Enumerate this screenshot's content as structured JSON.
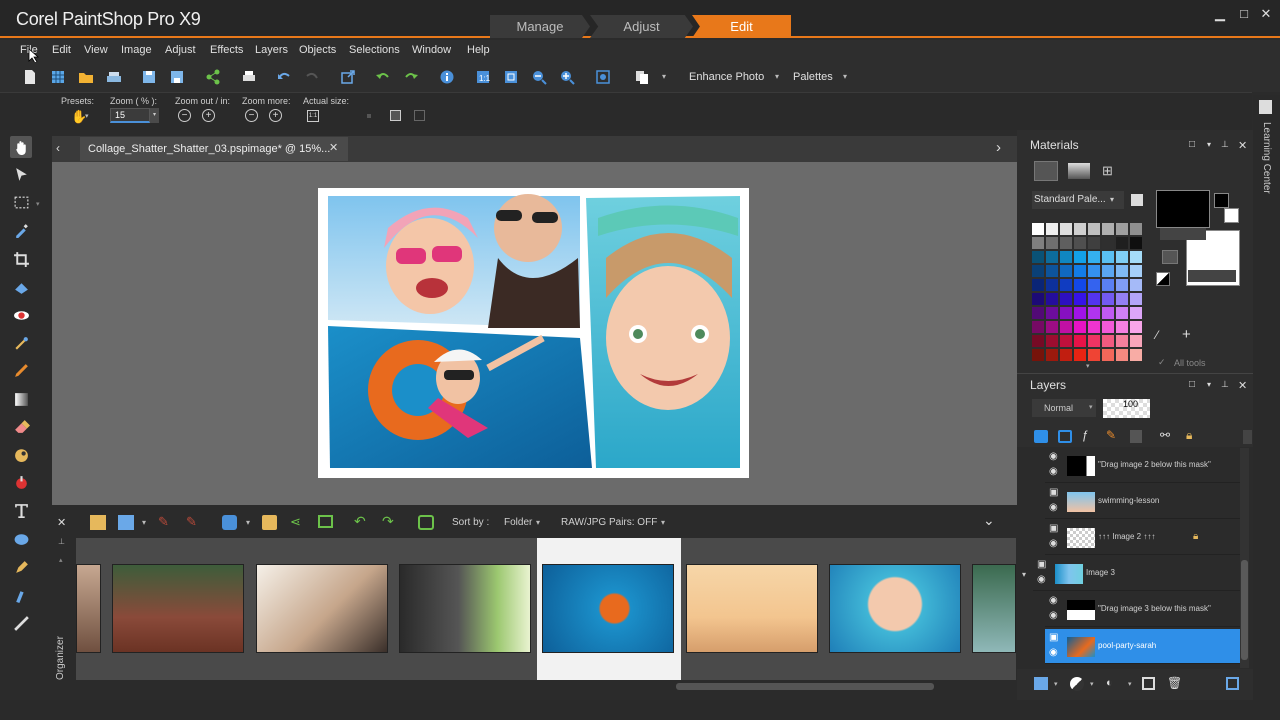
{
  "app": {
    "title": "Corel PaintShop Pro X9"
  },
  "workspace_tabs": [
    "Manage",
    "Adjust",
    "Edit"
  ],
  "menu": [
    "File",
    "Edit",
    "View",
    "Image",
    "Adjust",
    "Effects",
    "Layers",
    "Objects",
    "Selections",
    "Window",
    "Help"
  ],
  "toolbar": {
    "enhance_photo": "Enhance Photo",
    "palettes": "Palettes"
  },
  "tool_options": {
    "presets": "Presets:",
    "zoom_pct": "Zoom ( % ):",
    "zoom_value": "15",
    "zoom_out_in": "Zoom out / in:",
    "zoom_more": "Zoom more:",
    "actual_size": "Actual size:"
  },
  "document": {
    "tab_title": "Collage_Shatter_Shatter_03.pspimage* @  15%..."
  },
  "organizer": {
    "label": "Organizer",
    "sort_by": "Sort by :",
    "sort_value": "Folder",
    "raw_pairs": "RAW/JPG Pairs: OFF"
  },
  "materials": {
    "title": "Materials",
    "palette": "Standard Pale...",
    "all_tools": "All tools"
  },
  "layers": {
    "title": "Layers",
    "blend": "Normal",
    "opacity": "100",
    "rows": [
      {
        "name": "\"Drag image 2 below this mask\""
      },
      {
        "name": "swimming-lesson"
      },
      {
        "name": "↑↑↑ Image 2 ↑↑↑"
      },
      {
        "name": "Image 3"
      },
      {
        "name": "\"Drag image 3 below this mask\""
      },
      {
        "name": "pool-party-sarah"
      }
    ]
  },
  "learning_center": "Learning Center",
  "colors": {
    "accent": "#e8781a",
    "selected_layer": "#2f8fe8"
  }
}
